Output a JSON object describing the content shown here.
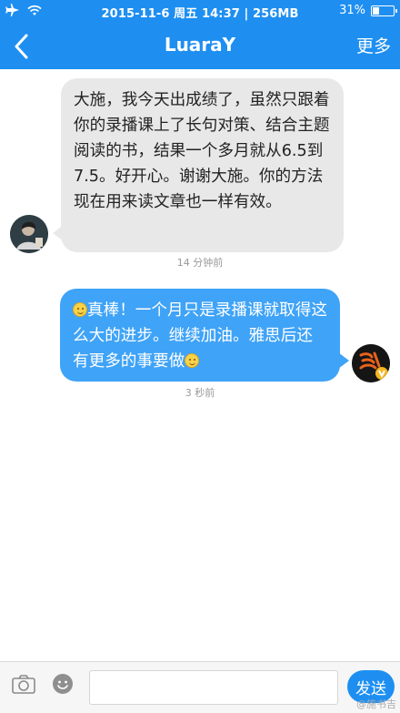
{
  "status_bar": {
    "datetime": "2015-11-6  周五 14:37 | 256MB",
    "battery": "31%",
    "battery_level": 0.31
  },
  "nav": {
    "title": "LuaraY",
    "more_label": "更多"
  },
  "messages": [
    {
      "side": "left",
      "text": "大施，我今天出成绩了，虽然只跟着你的录播课上了长句对策、结合主题阅读的书，结果一个多月就从6.5到7.5。好开心。谢谢大施。你的方法现在用来读文章也一样有效。",
      "time": "14 分钟前"
    },
    {
      "side": "right",
      "text_before_emoji": "真棒！一个月只是录播课就取得这么大的进步。继续加油。雅思后还有更多的事要做",
      "time": "3 秒前"
    }
  ],
  "input": {
    "placeholder": "",
    "send_label": "发送"
  },
  "watermark": "@施书吉"
}
